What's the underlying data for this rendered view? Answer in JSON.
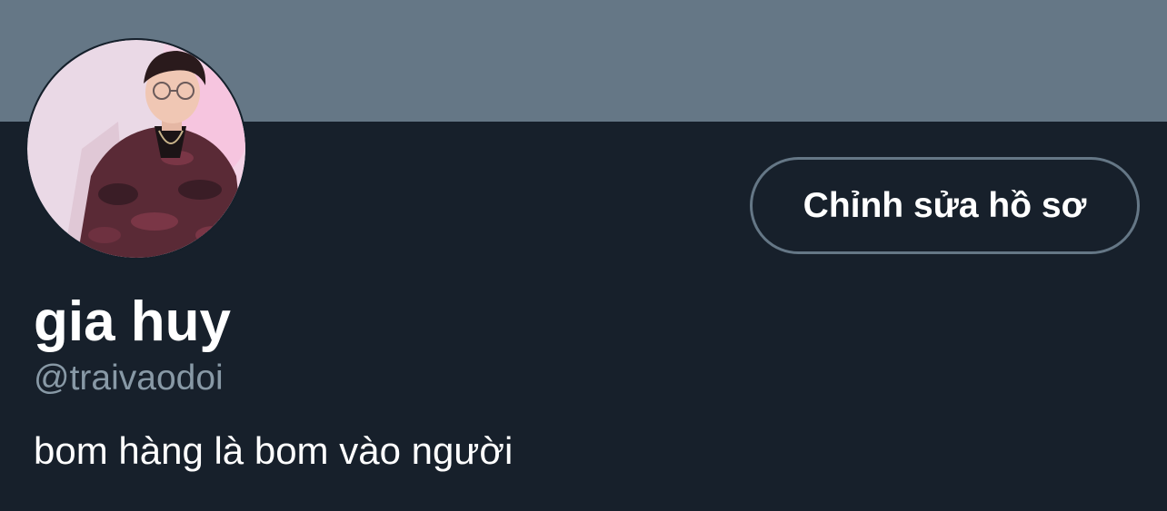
{
  "profile": {
    "display_name": "gia huy",
    "handle": "@traivaodoi",
    "bio": "bom hàng là bom vào người",
    "edit_profile_label": "Chỉnh sửa hồ sơ",
    "avatar_alt": "profile-photo"
  },
  "colors": {
    "banner": "#657786",
    "background": "#17202b",
    "primary_text": "#ffffff",
    "secondary_text": "#8899a6",
    "button_border": "#657786"
  }
}
